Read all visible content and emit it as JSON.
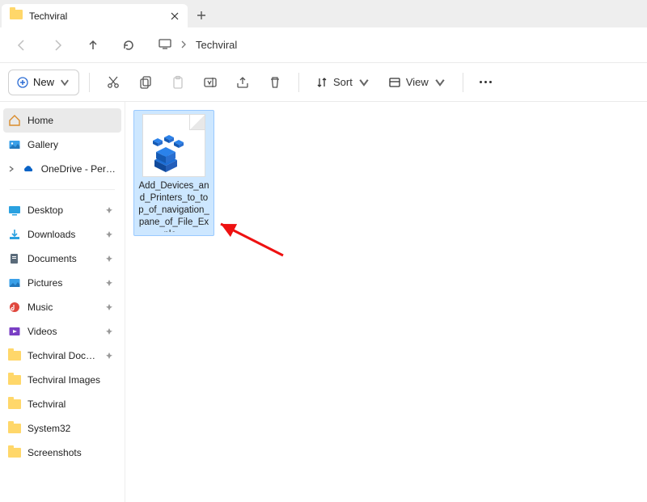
{
  "tab": {
    "title": "Techviral"
  },
  "breadcrumb": {
    "current": "Techviral"
  },
  "toolbar": {
    "new_label": "New",
    "sort_label": "Sort",
    "view_label": "View"
  },
  "sidebar": {
    "top": [
      {
        "label": "Home"
      },
      {
        "label": "Gallery"
      },
      {
        "label": "OneDrive - Persona"
      }
    ],
    "pinned": [
      {
        "label": "Desktop"
      },
      {
        "label": "Downloads"
      },
      {
        "label": "Documents"
      },
      {
        "label": "Pictures"
      },
      {
        "label": "Music"
      },
      {
        "label": "Videos"
      },
      {
        "label": "Techviral Docum"
      },
      {
        "label": "Techviral Images"
      },
      {
        "label": "Techviral"
      },
      {
        "label": "System32"
      },
      {
        "label": "Screenshots"
      }
    ]
  },
  "file": {
    "name": "Add_Devices_and_Printers_to_top_of_navigation_pane_of_File_Explo..."
  }
}
